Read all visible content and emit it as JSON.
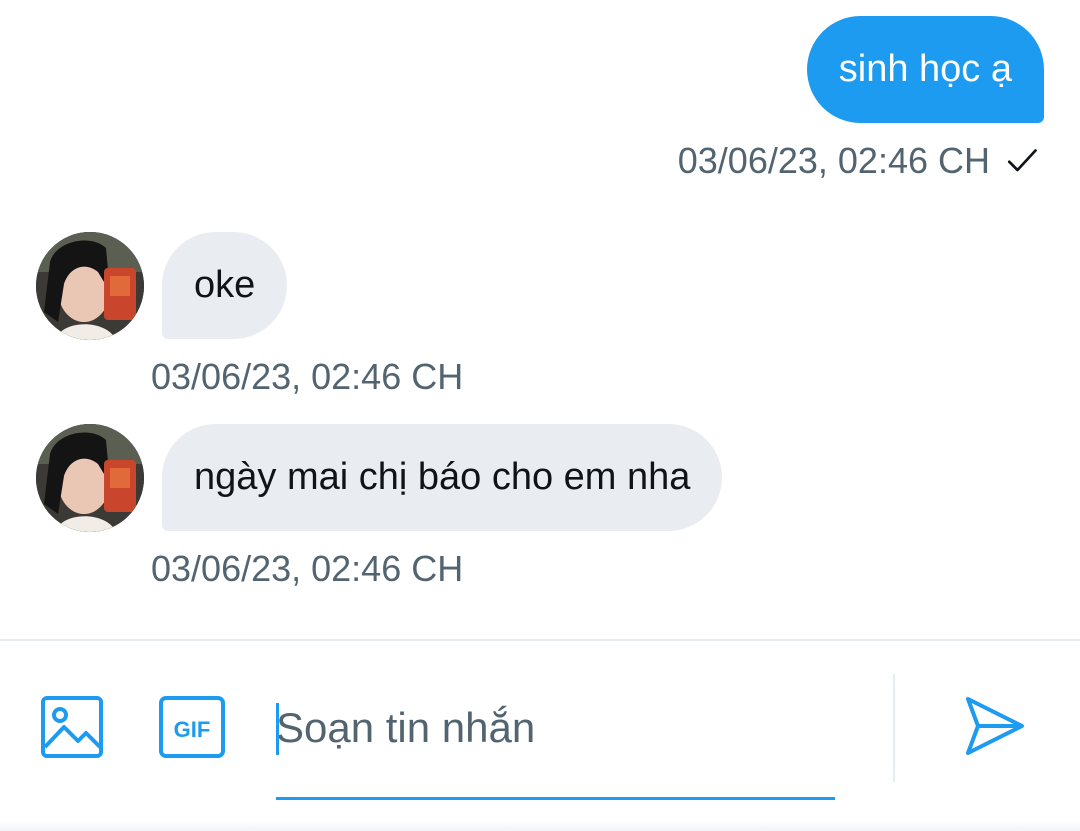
{
  "conversation": {
    "messages": [
      {
        "direction": "outgoing",
        "text": "sinh học ạ",
        "timestamp": "03/06/23, 02:46 CH",
        "status_icon": "check-icon"
      },
      {
        "direction": "incoming",
        "text": "oke",
        "timestamp": "03/06/23, 02:46 CH",
        "avatar": "avatar"
      },
      {
        "direction": "incoming",
        "text": "ngày mai chị báo cho em nha",
        "timestamp": "03/06/23, 02:46 CH",
        "avatar": "avatar"
      }
    ]
  },
  "composer": {
    "placeholder": "Soạn tin nhắn",
    "value": "",
    "image_icon": "image-icon",
    "gif_icon": "gif-icon",
    "gif_label": "GIF",
    "send_icon": "send-icon"
  },
  "colors": {
    "accent": "#1d9bf0",
    "incoming_bubble": "#e9edf1",
    "meta_text": "#536471",
    "divider": "#e6ecf0"
  }
}
